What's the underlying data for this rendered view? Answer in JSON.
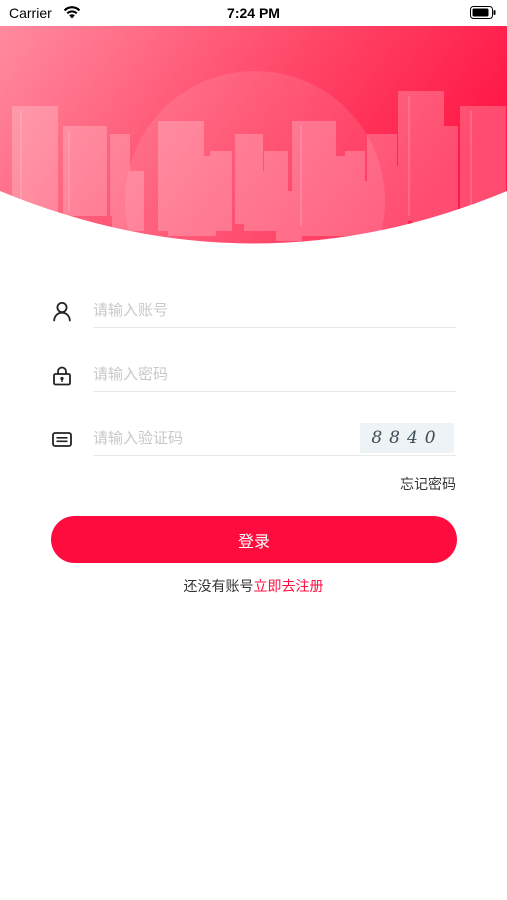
{
  "status_bar": {
    "carrier": "Carrier",
    "time": "7:24 PM"
  },
  "login_form": {
    "account_placeholder": "请输入账号",
    "password_placeholder": "请输入密码",
    "captcha_placeholder": "请输入验证码",
    "captcha_code": "8840",
    "forgot_password": "忘记密码",
    "login_button": "登录",
    "no_account_text": "还没有账号",
    "register_link": "立即去注册"
  },
  "theme": {
    "accent": "#ff0c3e",
    "header_gradient_start": "#ff8b9f",
    "header_gradient_end": "#ff1a48"
  }
}
